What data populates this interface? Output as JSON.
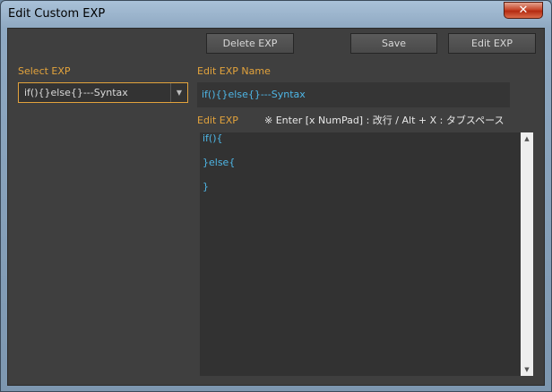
{
  "window": {
    "title": "Edit Custom EXP",
    "close_label": "✕"
  },
  "toolbar": {
    "delete_label": "Delete EXP",
    "save_label": "Save",
    "edit_label": "Edit EXP"
  },
  "select": {
    "label": "Select EXP",
    "value": "if(){}else{}---Syntax"
  },
  "name": {
    "label": "Edit EXP Name",
    "value": "if(){}else{}---Syntax"
  },
  "editor": {
    "label": "Edit EXP",
    "hint": "※ Enter [x NumPad] : 改行 / Alt + X : タブスペース",
    "lines": [
      "if(){",
      "}else{",
      "}"
    ]
  }
}
